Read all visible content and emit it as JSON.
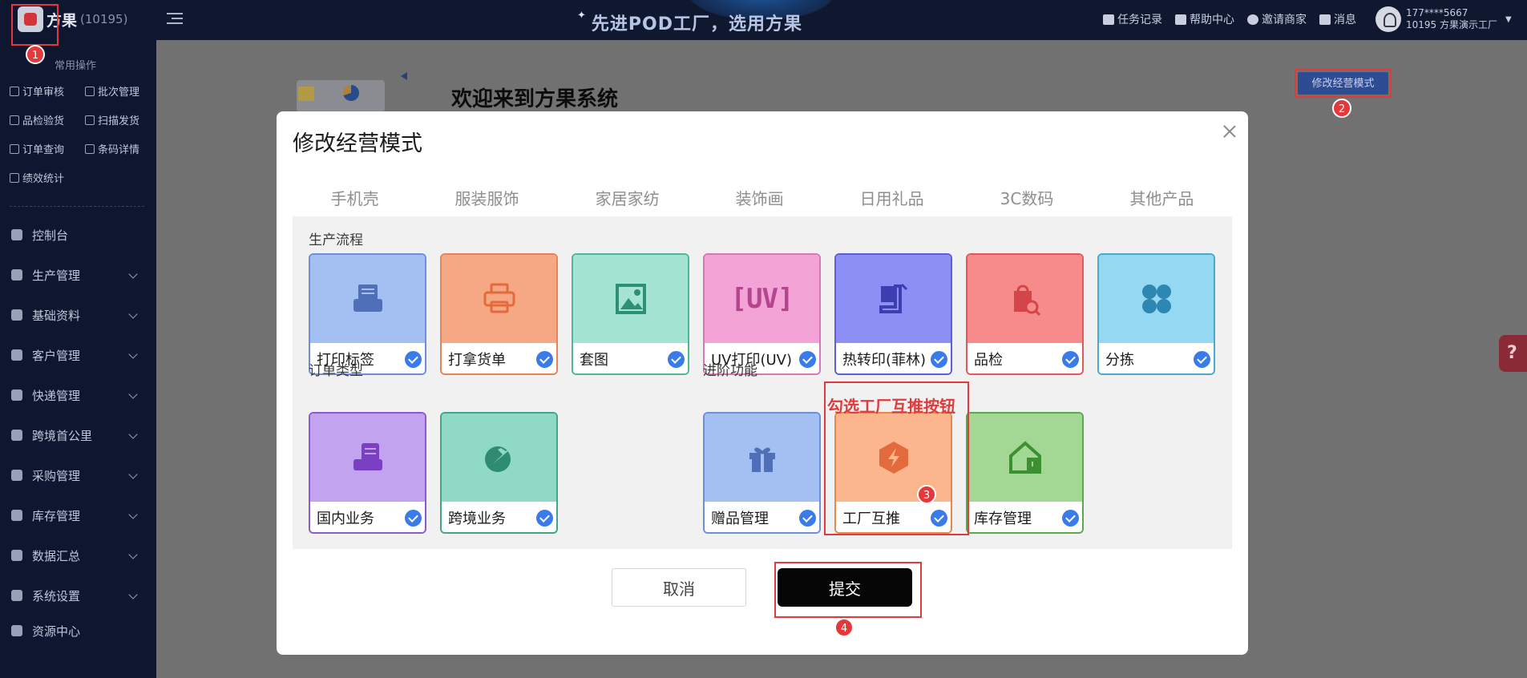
{
  "app": {
    "brand_name": "方果",
    "brand_code": "(10195)",
    "slogan": "先进POD工厂，选用方果"
  },
  "header": {
    "links": [
      {
        "label": "任务记录",
        "icon": "task-icon"
      },
      {
        "label": "帮助中心",
        "icon": "help-icon"
      },
      {
        "label": "邀请商家",
        "icon": "invite-icon"
      },
      {
        "label": "消息",
        "icon": "message-icon"
      }
    ],
    "user_phone": "177****5667",
    "user_factory": "10195 方果演示工厂"
  },
  "sidebar": {
    "common_title": "常用操作",
    "quick_actions": [
      "订单审核",
      "批次管理",
      "品检验货",
      "扫描发货",
      "订单查询",
      "条码详情",
      "绩效统计"
    ],
    "menu": [
      {
        "label": "控制台",
        "icon": "dashboard-icon",
        "expandable": false
      },
      {
        "label": "生产管理",
        "icon": "production-icon",
        "expandable": true
      },
      {
        "label": "基础资料",
        "icon": "basic-data-icon",
        "expandable": true
      },
      {
        "label": "客户管理",
        "icon": "customer-icon",
        "expandable": true
      },
      {
        "label": "快递管理",
        "icon": "express-icon",
        "expandable": true
      },
      {
        "label": "跨境首公里",
        "icon": "globe-icon",
        "expandable": true
      },
      {
        "label": "采购管理",
        "icon": "purchase-icon",
        "expandable": true
      },
      {
        "label": "库存管理",
        "icon": "inventory-icon",
        "expandable": true
      },
      {
        "label": "数据汇总",
        "icon": "chart-icon",
        "expandable": true
      },
      {
        "label": "系统设置",
        "icon": "settings-icon",
        "expandable": true
      },
      {
        "label": "资源中心",
        "icon": "resource-icon",
        "expandable": false
      }
    ]
  },
  "page": {
    "welcome_title": "欢迎来到方果系统",
    "mode_button": "修改经营模式"
  },
  "modal": {
    "title": "修改经营模式",
    "tabs": [
      "手机壳",
      "服装服饰",
      "家居家纺",
      "装饰画",
      "日用礼品",
      "3C数码",
      "其他产品"
    ],
    "sections": {
      "production": "生产流程",
      "order_type": "订单类型",
      "advanced": "进阶功能"
    },
    "cards": {
      "print_label": "打印标签",
      "pick_list": "打拿货单",
      "mockup": "套图",
      "uv_print": "UV打印(UV)",
      "heat_transfer": "热转印(菲林)",
      "quality_check": "品检",
      "sorting": "分拣",
      "domestic": "国内业务",
      "cross_border": "跨境业务",
      "gift": "赠品管理",
      "factory_push": "工厂互推",
      "inventory": "库存管理"
    },
    "cancel": "取消",
    "submit": "提交"
  },
  "annotations": {
    "n1": "1",
    "n2": "2",
    "n3": "3",
    "n4": "4",
    "hint": "勾选工厂互推按钮"
  },
  "colors": {
    "annotation_red": "#e23a3a",
    "check_blue": "#3a7bea",
    "sidebar_bg": "#0f1630"
  }
}
